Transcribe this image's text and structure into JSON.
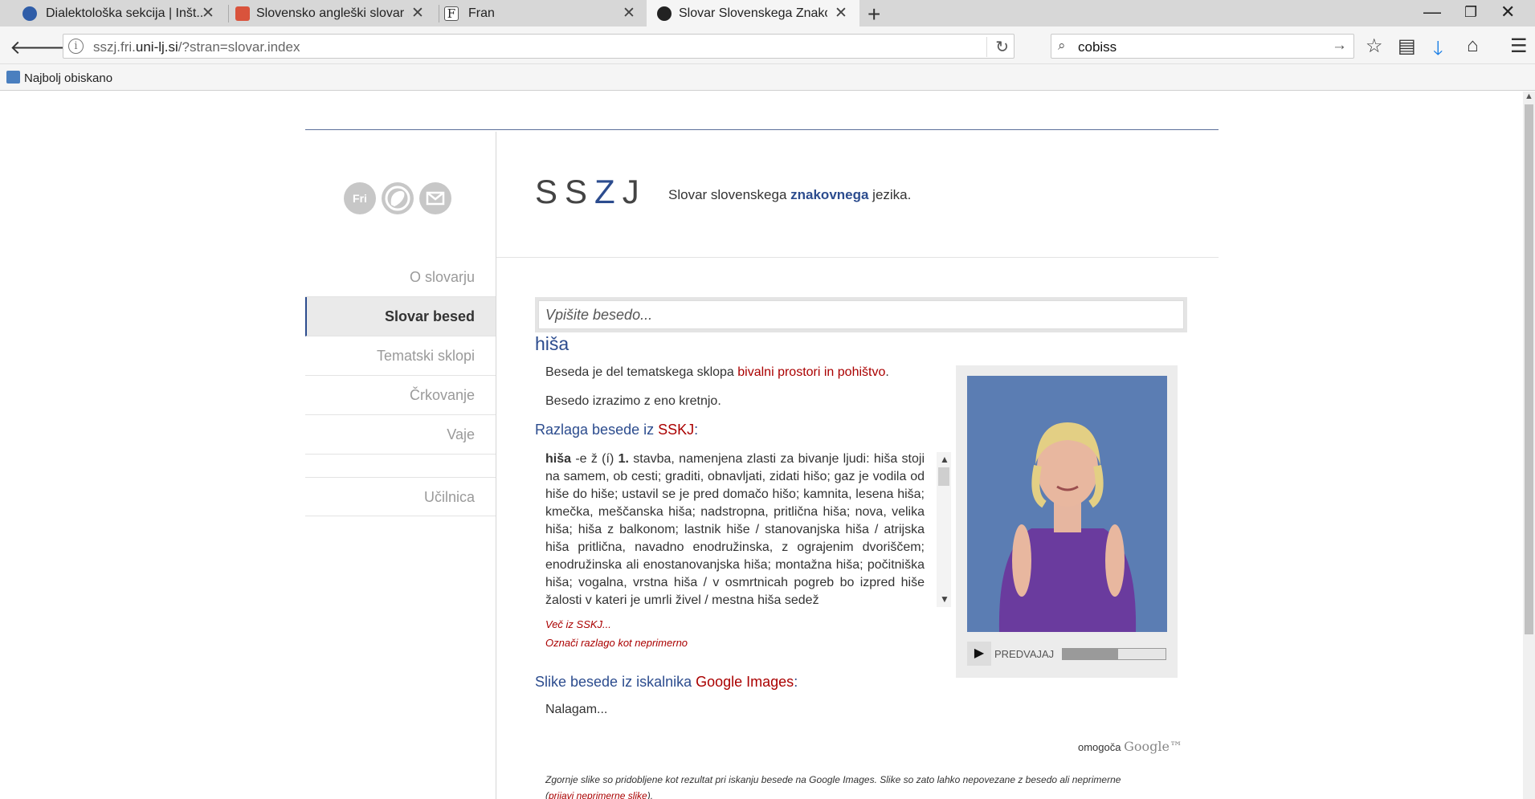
{
  "browser": {
    "tabs": [
      {
        "title": "Dialektološka sekcija | Inšt..."
      },
      {
        "title": "Slovensko angleški slovar ..."
      },
      {
        "title": "Fran"
      },
      {
        "title": "Slovar Slovenskega Znako..."
      }
    ],
    "url_prefix": "sszj.fri.",
    "url_domain": "uni-lj.si",
    "url_path": "/?stran=slovar.index",
    "search_query": "cobiss",
    "bookmark": "Najbolj obiskano"
  },
  "site": {
    "logo_pre": "SS",
    "logo_z": "Z",
    "logo_post": "J",
    "tagline_pre": "Slovar slovenskega ",
    "tagline_bold": "znakovnega",
    "tagline_post": " jezika.",
    "social": [
      "Fri",
      "",
      ""
    ]
  },
  "menu": [
    {
      "label": "O slovarju"
    },
    {
      "label": "Slovar besed"
    },
    {
      "label": "Tematski sklopi"
    },
    {
      "label": "Črkovanje"
    },
    {
      "label": "Vaje"
    },
    {
      "label": "Učilnica"
    }
  ],
  "search": {
    "placeholder": "Vpišite besedo..."
  },
  "entry": {
    "word": "hiša",
    "theme_pre": "Beseda je del tematskega sklopa ",
    "theme_link": "bivalni prostori in pohištvo",
    "theme_post": ".",
    "motion": "Besedo izrazimo z eno kretnjo.",
    "sskj_heading_pre": "Razlaga besede iz ",
    "sskj_heading_link": "SSKJ",
    "sskj_heading_post": ":",
    "definition_head": "hiša",
    "definition_gram": " -e ž (í) ",
    "definition_num": "1.",
    "definition_text": " stavba, namenjena zlasti za bivanje ljudi: hiša stoji na samem, ob cesti; graditi, obnavljati, zidati hišo; gaz je vodila od hiše do hiše; ustavil se je pred domačo hišo; kamnita, lesena hiša; kmečka, meščanska hiša; nadstropna, pritlična hiša; nova, velika hiša; hiša z balkonom; lastnik hiše / stanovanjska hiša / atrijska hiša pritlična, navadno enodružinska, z ograjenim dvoriščem; enodružinska ali enostanovanjska hiša; montažna hiša; počitniška hiša; vogalna, vrstna hiša / v osmrtnicah pogreb bo izpred hiše žalosti v kateri je umrli živel / mestna hiša sedež",
    "more_link": "Več iz SSKJ...",
    "flag_link": "Označi razlago kot neprimerno",
    "images_heading_pre": "Slike besede iz iskalnika ",
    "images_heading_link": "Google Images",
    "images_heading_post": ":",
    "loading": "Nalagam...",
    "powered_pre": "omogoča ",
    "powered_brand": "Google™",
    "disclaimer_text": "Zgornje slike so pridobljene kot rezultat pri iskanju besede na Google Images. Slike so zato lahko nepovezane z besedo ali neprimerne (",
    "disclaimer_link": "prijavi neprimerne slike",
    "disclaimer_end": ")."
  },
  "video": {
    "play_label": "PREDVAJAJ",
    "progress": 0.54
  }
}
